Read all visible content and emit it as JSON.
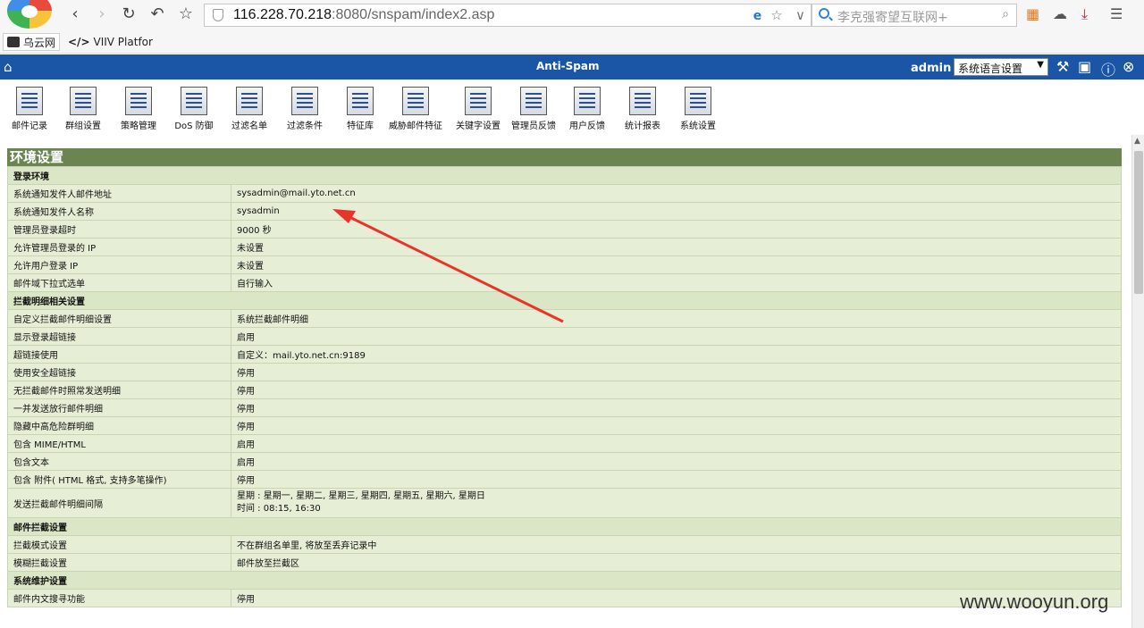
{
  "browser": {
    "url_host": "116.228.70.218",
    "url_rest": ":8080/snspam/index2.asp",
    "search_placeholder": "李克强寄望互联网+",
    "bookmarks": [
      "乌云网",
      "VIIV Platfor"
    ]
  },
  "header": {
    "title": "Anti-Spam",
    "user": "admin",
    "language_label": "系统语言设置"
  },
  "toolbar": [
    {
      "label": "邮件记录",
      "icon": "mail-log-icon"
    },
    {
      "label": "群组设置",
      "icon": "group-icon"
    },
    {
      "label": "策略管理",
      "icon": "policy-icon"
    },
    {
      "label": "DoS 防御",
      "icon": "dos-icon"
    },
    {
      "label": "过滤名单",
      "icon": "filter-list-icon"
    },
    {
      "label": "过滤条件",
      "icon": "filter-condition-icon"
    },
    {
      "label": "特征库",
      "icon": "signature-icon"
    },
    {
      "label": "威胁邮件特征",
      "icon": "threat-icon"
    },
    {
      "label": "关键字设置",
      "icon": "keyword-icon"
    },
    {
      "label": "管理员反馈",
      "icon": "admin-feedback-icon"
    },
    {
      "label": "用户反馈",
      "icon": "user-feedback-icon"
    },
    {
      "label": "统计报表",
      "icon": "report-icon"
    },
    {
      "label": "系统设置",
      "icon": "system-settings-icon"
    }
  ],
  "section_title": "环境设置",
  "rows": [
    {
      "type": "group",
      "key": "登录环境"
    },
    {
      "key": "系统通知发件人邮件地址",
      "value": "sysadmin@mail.yto.net.cn"
    },
    {
      "key": "系统通知发件人名称",
      "value": "sysadmin"
    },
    {
      "key": "管理员登录超时",
      "value": "9000 秒"
    },
    {
      "key": "允许管理员登录的 IP",
      "value": "未设置"
    },
    {
      "key": "允许用户登录 IP",
      "value": "未设置"
    },
    {
      "key": "邮件域下拉式选单",
      "value": "自行输入"
    },
    {
      "type": "group",
      "key": "拦截明细相关设置"
    },
    {
      "key": "自定义拦截邮件明细设置",
      "value": "系统拦截邮件明细"
    },
    {
      "key": "显示登录超链接",
      "value": "启用"
    },
    {
      "key": "超链接使用",
      "value": "自定义：mail.yto.net.cn:9189"
    },
    {
      "key": "使用安全超链接",
      "value": "停用"
    },
    {
      "key": "无拦截邮件时照常发送明细",
      "value": "停用"
    },
    {
      "key": "一并发送放行邮件明细",
      "value": "停用"
    },
    {
      "key": "隐藏中高危险群明细",
      "value": "停用"
    },
    {
      "key": "包含 MIME/HTML",
      "value": "启用"
    },
    {
      "key": "包含文本",
      "value": "启用"
    },
    {
      "key": "包含 附件( HTML 格式, 支持多笔操作)",
      "value": "停用"
    },
    {
      "type": "tall",
      "key": "发送拦截邮件明细间隔",
      "value": "星期 : 星期一, 星期二, 星期三, 星期四, 星期五, 星期六, 星期日",
      "value2": "时间 : 08:15, 16:30"
    },
    {
      "type": "group",
      "key": "邮件拦截设置"
    },
    {
      "key": "拦截模式设置",
      "value": "不在群组名单里, 将放至丢弃记录中"
    },
    {
      "key": "模糊拦截设置",
      "value": "邮件放至拦截区"
    },
    {
      "type": "group",
      "key": "系统维护设置"
    },
    {
      "key": "邮件内文搜寻功能",
      "value": "停用"
    }
  ],
  "watermark": "www.wooyun.org",
  "colors": {
    "header": "#1a55a6",
    "section": "#6b8451",
    "cell": "#e6eed6",
    "arrow": "#e8352b"
  }
}
